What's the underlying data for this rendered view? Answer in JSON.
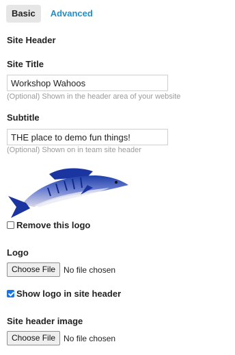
{
  "tabs": [
    {
      "label": "Basic",
      "active": true
    },
    {
      "label": "Advanced",
      "active": false
    }
  ],
  "section_title": "Site Header",
  "site_title": {
    "label": "Site Title",
    "value": "Workshop Wahoos",
    "help": "(Optional) Shown in the header area of your website"
  },
  "subtitle": {
    "label": "Subtitle",
    "value": "THE place to demo fun things!",
    "help": "(Optional) Shown on in team site header"
  },
  "logo_preview": {
    "icon": "wahoo-fish-logo"
  },
  "remove_logo": {
    "label": "Remove this logo",
    "checked": false
  },
  "logo_upload": {
    "label": "Logo",
    "button": "Choose File",
    "status": "No file chosen"
  },
  "show_logo": {
    "label": "Show logo in site header",
    "checked": true
  },
  "header_image": {
    "label": "Site header image",
    "button": "Choose File",
    "status": "No file chosen"
  },
  "colors": {
    "accent": "#1e8fc9",
    "help_text": "#9a9a9a",
    "active_tab_bg": "#e6e6e6"
  }
}
